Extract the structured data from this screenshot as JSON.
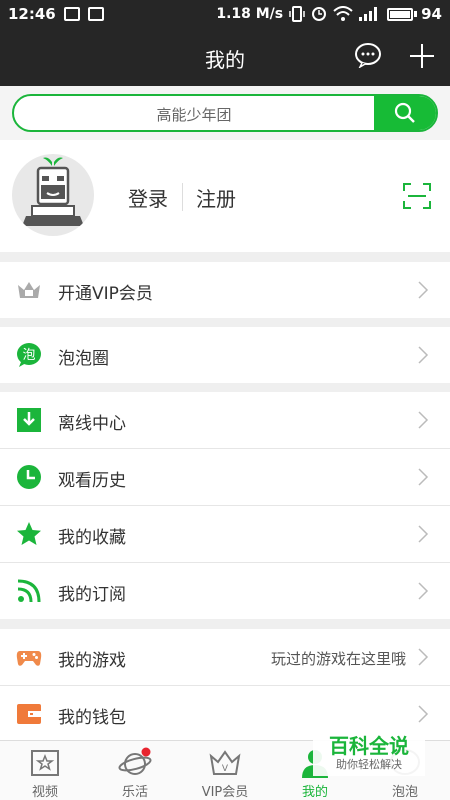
{
  "status_bar": {
    "time": "12:46",
    "network_speed": "1.18 M/s",
    "battery": "94"
  },
  "header": {
    "title": "我的",
    "message_icon": "chat-bubble-icon",
    "add_icon": "plus-icon"
  },
  "search": {
    "text": "高能少年团",
    "icon": "search-icon"
  },
  "profile": {
    "login": "登录",
    "register": "注册",
    "scan_icon": "scan-icon"
  },
  "menu": {
    "vip": "开通VIP会员",
    "bubble": "泡泡圈",
    "offline": "离线中心",
    "history": "观看历史",
    "favorites": "我的收藏",
    "subscriptions": "我的订阅",
    "games": "我的游戏",
    "games_hint": "玩过的游戏在这里哦",
    "wallet": "我的钱包"
  },
  "tabs": {
    "video": "视频",
    "fun": "乐活",
    "vip": "VIP会员",
    "mine": "我的",
    "bubble": "泡泡"
  },
  "watermark": {
    "title": "百科全说",
    "subtitle": "助你轻松解决"
  },
  "colors": {
    "accent": "#1bb53b",
    "header_bg": "#262626",
    "games_icon": "#f08a4b",
    "wallet_icon": "#f07a3a"
  }
}
